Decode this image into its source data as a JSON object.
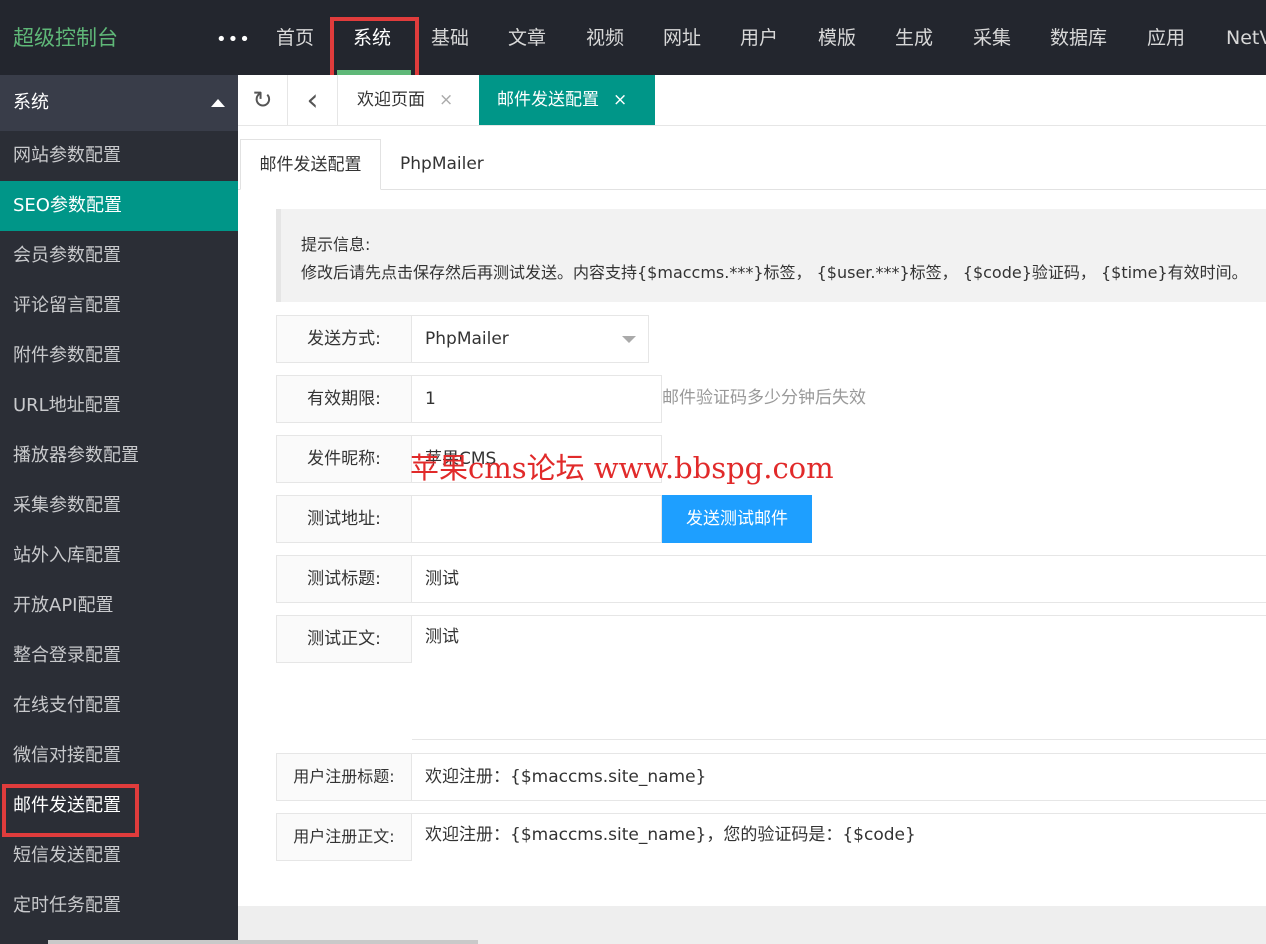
{
  "app": {
    "title": "超级控制台",
    "more": "•••"
  },
  "topnav": [
    "首页",
    "系统",
    "基础",
    "文章",
    "视频",
    "网址",
    "用户",
    "模版",
    "生成",
    "采集",
    "数据库",
    "应用",
    "NetV"
  ],
  "sidebar": {
    "header": "系统",
    "items": [
      "网站参数配置",
      "SEO参数配置",
      "会员参数配置",
      "评论留言配置",
      "附件参数配置",
      "URL地址配置",
      "播放器参数配置",
      "采集参数配置",
      "站外入库配置",
      "开放API配置",
      "整合登录配置",
      "在线支付配置",
      "微信对接配置",
      "邮件发送配置",
      "短信发送配置",
      "定时任务配置"
    ]
  },
  "tabs": {
    "refresh_icon": "↻",
    "back_icon": "‹",
    "close_icon": "×",
    "items": [
      "欢迎页面",
      "邮件发送配置"
    ]
  },
  "form_tabs": [
    "邮件发送配置",
    "PhpMailer"
  ],
  "notice": {
    "title": "提示信息:",
    "text": "修改后请先点击保存然后再测试发送。内容支持{$maccms.***}标签， {$user.***}标签， {$code}验证码， {$time}有效时间。"
  },
  "form": {
    "send_method": {
      "label": "发送方式:",
      "value": "PhpMailer"
    },
    "expire": {
      "label": "有效期限:",
      "value": "1",
      "hint": "邮件验证码多少分钟后失效"
    },
    "nickname": {
      "label": "发件昵称:",
      "value": "苹果CMS"
    },
    "test_address": {
      "label": "测试地址:",
      "value": "",
      "button": "发送测试邮件"
    },
    "test_title": {
      "label": "测试标题:",
      "value": "测试"
    },
    "test_body": {
      "label": "测试正文:",
      "value": "测试"
    },
    "reg_title": {
      "label": "用户注册标题:",
      "value": "欢迎注册：{$maccms.site_name}"
    },
    "reg_body": {
      "label": "用户注册正文:",
      "value": "欢迎注册：{$maccms.site_name}，您的验证码是：{$code}"
    }
  },
  "watermark": "苹果cms论坛 www.bbspg.com",
  "colors": {
    "accent": "#009688",
    "nav_bg": "#23262e",
    "sidebar_bg": "#2b2e36",
    "logo": "#5fb878",
    "button": "#1e9fff",
    "highlight": "#e03c3c"
  }
}
